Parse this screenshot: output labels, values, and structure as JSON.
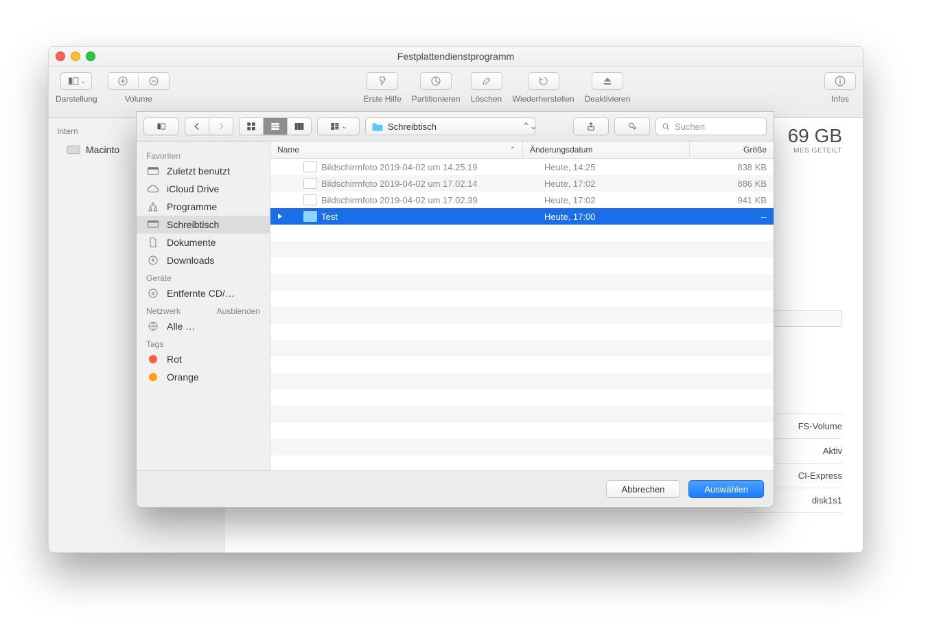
{
  "window": {
    "title": "Festplattendienstprogramm"
  },
  "toolbar": {
    "view_label": "Darstellung",
    "volume_label": "Volume",
    "firstaid_label": "Erste Hilfe",
    "partition_label": "Partitionieren",
    "erase_label": "Löschen",
    "restore_label": "Wiederherstellen",
    "unmount_label": "Deaktivieren",
    "info_label": "Infos"
  },
  "du_sidebar": {
    "internal_header": "Intern",
    "disk_name": "Macinto"
  },
  "du_content": {
    "size": "69 GB",
    "subtitle": "MES GETEILT",
    "info_rows": [
      "FS-Volume",
      "Aktiv",
      "CI-Express",
      "disk1s1"
    ]
  },
  "open_panel": {
    "location_label": "Schreibtisch",
    "search_placeholder": "Suchen",
    "sidebar": {
      "favorites_header": "Favoriten",
      "devices_header": "Geräte",
      "network_header": "Netzwerk",
      "network_hide": "Ausblenden",
      "tags_header": "Tags",
      "items": {
        "recent": "Zuletzt benutzt",
        "icloud": "iCloud Drive",
        "apps": "Programme",
        "desktop": "Schreibtisch",
        "documents": "Dokumente",
        "downloads": "Downloads",
        "remote_cd": "Entfernte CD/…",
        "all_net": "Alle …",
        "tag_red": "Rot",
        "tag_orange": "Orange"
      }
    },
    "columns": {
      "name": "Name",
      "date": "Änderungsdatum",
      "size": "Größe"
    },
    "files": [
      {
        "name": "Bildschirmfoto 2019-04-02 um 14.25.19",
        "date": "Heute, 14:25",
        "size": "838 KB",
        "type": "file"
      },
      {
        "name": "Bildschirmfoto 2019-04-02 um 17.02.14",
        "date": "Heute, 17:02",
        "size": "886 KB",
        "type": "file"
      },
      {
        "name": "Bildschirmfoto 2019-04-02 um 17.02.39",
        "date": "Heute, 17:02",
        "size": "941 KB",
        "type": "file"
      },
      {
        "name": "Test",
        "date": "Heute, 17:00",
        "size": "--",
        "type": "folder",
        "selected": true
      }
    ],
    "buttons": {
      "cancel": "Abbrechen",
      "choose": "Auswählen"
    }
  }
}
